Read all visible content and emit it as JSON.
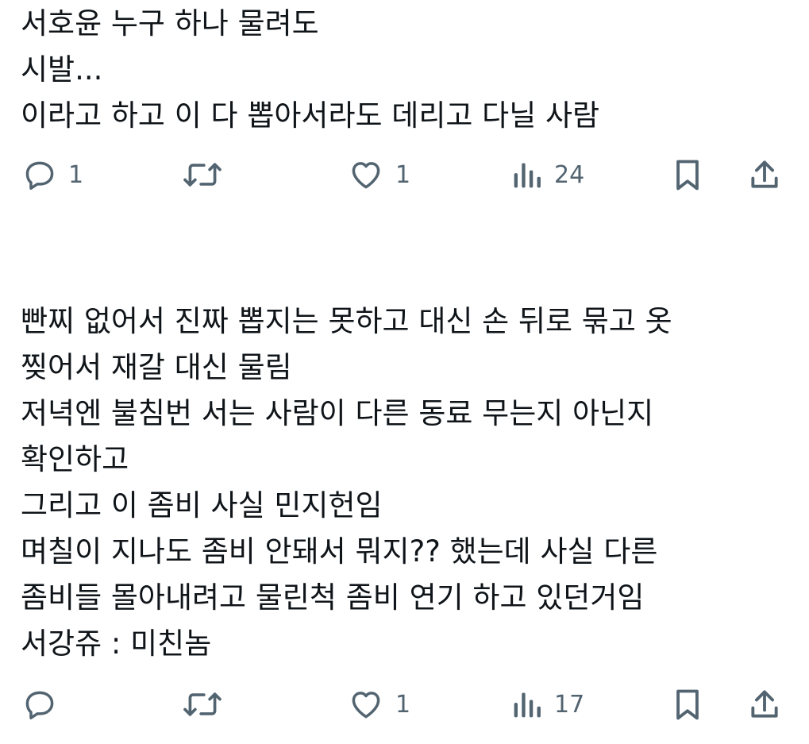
{
  "posts": [
    {
      "lines": [
        "서호윤 누구 하나 물려도",
        "시발...",
        "이라고 하고 이 다 뽑아서라도 데리고 다닐 사람"
      ],
      "actions": {
        "reply_count": "1",
        "repost_count": "",
        "like_count": "1",
        "views_count": "24"
      }
    },
    {
      "lines": [
        "빤찌 없어서 진짜 뽑지는 못하고 대신 손 뒤로 묶고 옷",
        "찢어서 재갈 대신 물림",
        "저녁엔 불침번 서는 사람이 다른 동료 무는지 아닌지",
        "확인하고",
        "그리고 이 좀비 사실 민지헌임",
        "며칠이 지나도 좀비 안돼서 뭐지?? 했는데 사실 다른",
        "좀비들 몰아내려고 물린척 좀비 연기 하고 있던거임",
        "서강쥬 : 미친놈"
      ],
      "actions": {
        "reply_count": "",
        "repost_count": "",
        "like_count": "1",
        "views_count": "17"
      }
    }
  ],
  "icons": {
    "reply": "speech-bubble-icon",
    "repost": "repost-arrows-icon",
    "like": "heart-icon",
    "views": "bar-chart-icon",
    "bookmark": "bookmark-icon",
    "share": "share-upload-icon"
  },
  "colors": {
    "text": "#0f1419",
    "icon": "#536471",
    "background": "#ffffff"
  }
}
